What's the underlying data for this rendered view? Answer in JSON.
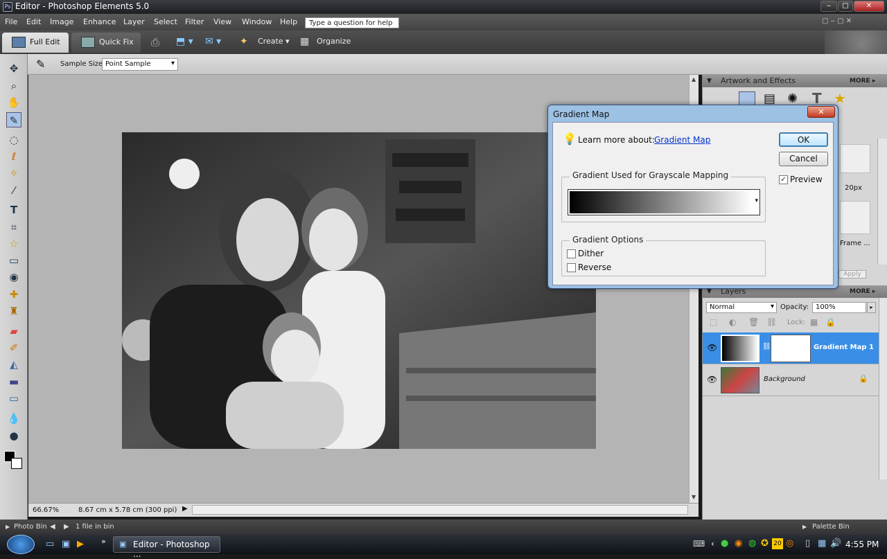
{
  "window": {
    "title": "Editor - Photoshop Elements 5.0",
    "min_icon": "minimize-icon",
    "max_icon": "maximize-icon",
    "close_icon": "close-icon",
    "close_glyph": "✕"
  },
  "menu": {
    "items": [
      "File",
      "Edit",
      "Image",
      "Enhance",
      "Layer",
      "Select",
      "Filter",
      "View",
      "Window",
      "Help"
    ],
    "help_placeholder": "Type a question for help"
  },
  "mode_tabs": {
    "full_edit": "Full Edit",
    "quick_fix": "Quick Fix",
    "create": "Create",
    "organize": "Organize"
  },
  "options_bar": {
    "sample_size_label": "Sample Size:",
    "sample_size_value": "Point Sample"
  },
  "status": {
    "zoom": "66.67%",
    "doc_info": "8.67 cm x 5.78 cm (300 ppi)"
  },
  "artwork_panel": {
    "title": "Artwork and Effects",
    "more": "MORE",
    "thumb1_label": "20px",
    "thumb2_label": "Frame ...",
    "apply": "Apply"
  },
  "layers_panel": {
    "title": "Layers",
    "more": "MORE",
    "blend_mode": "Normal",
    "opacity_label": "Opacity:",
    "opacity_value": "100%",
    "lock_label": "Lock:",
    "layers": [
      {
        "name": "Gradient Map 1",
        "selected": true
      },
      {
        "name": "Background",
        "selected": false
      }
    ]
  },
  "bottom_bar": {
    "photo_bin": "Photo Bin",
    "files_in_bin": "1 file in bin",
    "palette_bin": "Palette Bin"
  },
  "dialog": {
    "title": "Gradient Map",
    "learn_more": "Learn more about:",
    "learn_link": "Gradient Map",
    "ok": "OK",
    "cancel": "Cancel",
    "preview": "Preview",
    "preview_checked": true,
    "gradient_group": "Gradient Used for Grayscale Mapping",
    "options_group": "Gradient Options",
    "dither": "Dither",
    "dither_checked": false,
    "reverse": "Reverse",
    "reverse_checked": false
  },
  "taskbar": {
    "task_label": "Editor - Photoshop ...",
    "clock": "4:55 PM",
    "tray_badge": "20"
  },
  "colors": {
    "accent": "#3a8ee6",
    "link": "#0033cc",
    "selected_layer": "#3a8ee6"
  }
}
